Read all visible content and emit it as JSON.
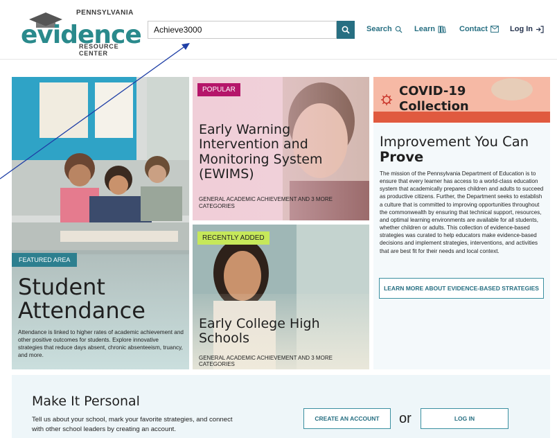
{
  "header": {
    "logo": {
      "state": "PENNSYLVANIA",
      "word": "evidence",
      "sub": "RESOURCE CENTER"
    },
    "search": {
      "value": "Achieve3000",
      "placeholder": ""
    },
    "nav": [
      {
        "label": "Search",
        "icon": "search-icon"
      },
      {
        "label": "Learn",
        "icon": "books-icon"
      },
      {
        "label": "Contact",
        "icon": "mail-icon"
      },
      {
        "label": "Log In",
        "icon": "login-icon"
      }
    ]
  },
  "featured": {
    "tag": "FEATURED AREA",
    "title_line1": "Student",
    "title_line2": "Attendance",
    "description": "Attendance is linked to higher rates of academic achievement and other positive outcomes for students. Explore innovative strategies that reduce days absent, chronic absenteeism, truancy, and more."
  },
  "popular": {
    "tag": "POPULAR",
    "title": "Early Warning Intervention and Monitoring System (EWIMS)",
    "categories": "GENERAL ACADEMIC ACHIEVEMENT AND 3 MORE CATEGORIES"
  },
  "recent": {
    "tag": "RECENTLY ADDED",
    "title": "Early College High Schools",
    "categories": "GENERAL ACADEMIC ACHIEVEMENT AND 3 MORE CATEGORIES"
  },
  "covid": {
    "line1": "COVID-19",
    "line2": "Collection"
  },
  "improvement": {
    "title_line1": "Improvement You Can",
    "title_line2": "Prove",
    "body": "The mission of the Pennsylvania Department of Education is to ensure that every learner has access to a world-class education system that academically prepares children and adults to succeed as productive citizens. Further, the Department seeks to establish a culture that is committed to improving opportunities throughout the commonwealth by ensuring that technical support, resources, and optimal learning environments are available for all students, whether children or adults. This collection of evidence-based strategies was curated to help educators make evidence-based decisions and implement strategies, interventions, and activities that are best fit for their needs and local context.",
    "cta": "LEARN MORE ABOUT EVIDENCE-BASED STRATEGIES"
  },
  "personal": {
    "title": "Make It Personal",
    "body": "Tell us about your school, mark your favorite strategies, and connect with other school leaders by creating an account.",
    "create_label": "CREATE AN ACCOUNT",
    "or_label": "or",
    "login_label": "LOG IN"
  },
  "colors": {
    "teal": "#276f82",
    "popular_tag": "#b5156a",
    "recent_tag": "#c6e85a",
    "featured_tag": "#2d7f8f",
    "covid_red": "#e05a3f"
  }
}
